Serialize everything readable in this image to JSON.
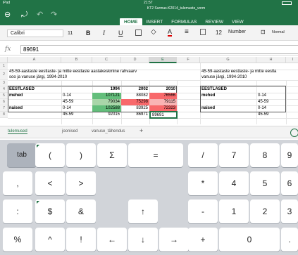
{
  "status": {
    "device": "iPad",
    "time": "21:57"
  },
  "app": {
    "file_title": "KT2 Surmus-K2014_tulemuste_vorm",
    "ribbon_tabs": [
      "HOME",
      "INSERT",
      "FORMULAS",
      "REVIEW",
      "VIEW"
    ],
    "active_tab": "HOME"
  },
  "toolbar": {
    "font_name": "Calibri",
    "font_size": "11",
    "bold": "B",
    "italic": "I",
    "underline": "U",
    "font_color_letter": "A",
    "number_size": "12",
    "number_format": "Number",
    "cell_style": "Normal"
  },
  "formula_bar": {
    "fx": "fx",
    "value": "89691"
  },
  "sheet": {
    "columns": [
      "A",
      "B",
      "C",
      "D",
      "E",
      "F",
      "G",
      "H",
      "I"
    ],
    "rows": [
      "1",
      "2",
      "3",
      "4",
      "5",
      "6",
      "7",
      "8"
    ],
    "title_line1": "45-59-aastaste eestlaste- ja mitte eestlaste aastakeskmine rahvaarv",
    "title_line2": "soo ja vanuse järgi, 1994-2010",
    "right_title_line1": "45-59-aastaste eestlaste- ja mitte eestla",
    "right_title_line2": "vanuse järgi, 1994-2010",
    "header": {
      "label": "EESTLASED",
      "y1994": "1994",
      "y2002": "2002",
      "y2010": "2010"
    },
    "data": [
      {
        "group": "mehed",
        "age": "0-14",
        "v1994": "107121",
        "v2002": "88082",
        "v2010": "76566"
      },
      {
        "group": "",
        "age": "45-59",
        "v1994": "79034",
        "v2002": "75298",
        "v2010": "79115"
      },
      {
        "group": "naised",
        "age": "0-14",
        "v1994": "102588",
        "v2002": "83925",
        "v2010": "72323"
      },
      {
        "group": "",
        "age": "45-59",
        "v1994": "92015",
        "v2002": "86971",
        "v2010": "89691"
      }
    ],
    "right_data": [
      {
        "group": "EESTLASED",
        "age": ""
      },
      {
        "group": "mehed",
        "age": "0-14"
      },
      {
        "group": "",
        "age": "45-59"
      },
      {
        "group": "naised",
        "age": "0-14"
      },
      {
        "group": "",
        "age": "45-59"
      }
    ]
  },
  "sheet_tabs": [
    "tulemused",
    "joonised",
    "vanuse_tähendus"
  ],
  "active_sheet": "tulemused",
  "keyboard": {
    "row1": [
      "tab",
      "(",
      ")",
      "Σ",
      "=",
      "/",
      "7",
      "8",
      "9"
    ],
    "row2": [
      ",",
      "<",
      ">",
      "*",
      "4",
      "5",
      "6"
    ],
    "row3": [
      ":",
      "$",
      "&",
      "↑",
      "-",
      "1",
      "2",
      "3"
    ],
    "row4": [
      "%",
      "^",
      "!",
      "←",
      "↓",
      "→",
      "+",
      "0",
      "."
    ]
  },
  "colors": {
    "excel_green": "#217346",
    "highlight_green": "#63be7b",
    "highlight_red": "#f8696b",
    "light_red": "#f9b4b4"
  }
}
